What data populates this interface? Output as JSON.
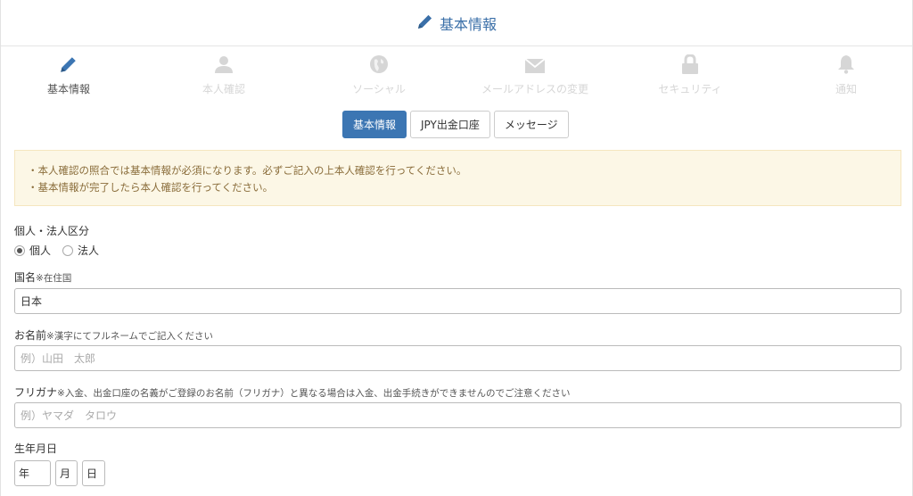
{
  "header": {
    "title": "基本情報",
    "icon": "pencil-icon"
  },
  "nav": {
    "items": [
      {
        "label": "基本情報",
        "icon": "pencil-icon",
        "active": true
      },
      {
        "label": "本人確認",
        "icon": "user-icon",
        "active": false
      },
      {
        "label": "ソーシャル",
        "icon": "globe-icon",
        "active": false
      },
      {
        "label": "メールアドレスの変更",
        "icon": "envelope-icon",
        "active": false
      },
      {
        "label": "セキュリティ",
        "icon": "lock-icon",
        "active": false
      },
      {
        "label": "通知",
        "icon": "bell-icon",
        "active": false
      }
    ]
  },
  "subtabs": [
    {
      "label": "基本情報",
      "active": true
    },
    {
      "label": "JPY出金口座",
      "active": false
    },
    {
      "label": "メッセージ",
      "active": false
    }
  ],
  "notice": {
    "lines": [
      "・本人確認の照合では基本情報が必須になります。必ずご記入の上本人確認を行ってください。",
      "・基本情報が完了したら本人確認を行ってください。"
    ]
  },
  "form": {
    "entity_type": {
      "label": "個人・法人区分",
      "options": [
        "個人",
        "法人"
      ],
      "selected": "個人"
    },
    "country": {
      "label": "国名",
      "note": "※在住国",
      "value": "日本"
    },
    "name": {
      "label": "お名前",
      "note": "※漢字にてフルネームでご記入ください",
      "placeholder": "例）山田　太郎"
    },
    "furigana": {
      "label": "フリガナ",
      "note": "※入金、出金口座の名義がご登録のお名前（フリガナ）と異なる場合は入金、出金手続きができませんのでご注意ください",
      "placeholder": "例）ヤマダ　タロウ"
    },
    "birthdate": {
      "label": "生年月日",
      "year_placeholder": "年",
      "month_placeholder": "月",
      "day_placeholder": "日"
    }
  },
  "colors": {
    "accent": "#3c76b3",
    "nav_inactive": "#d6d6d6",
    "notice_bg": "#fcf7e6",
    "notice_text": "#8a6d3b"
  }
}
